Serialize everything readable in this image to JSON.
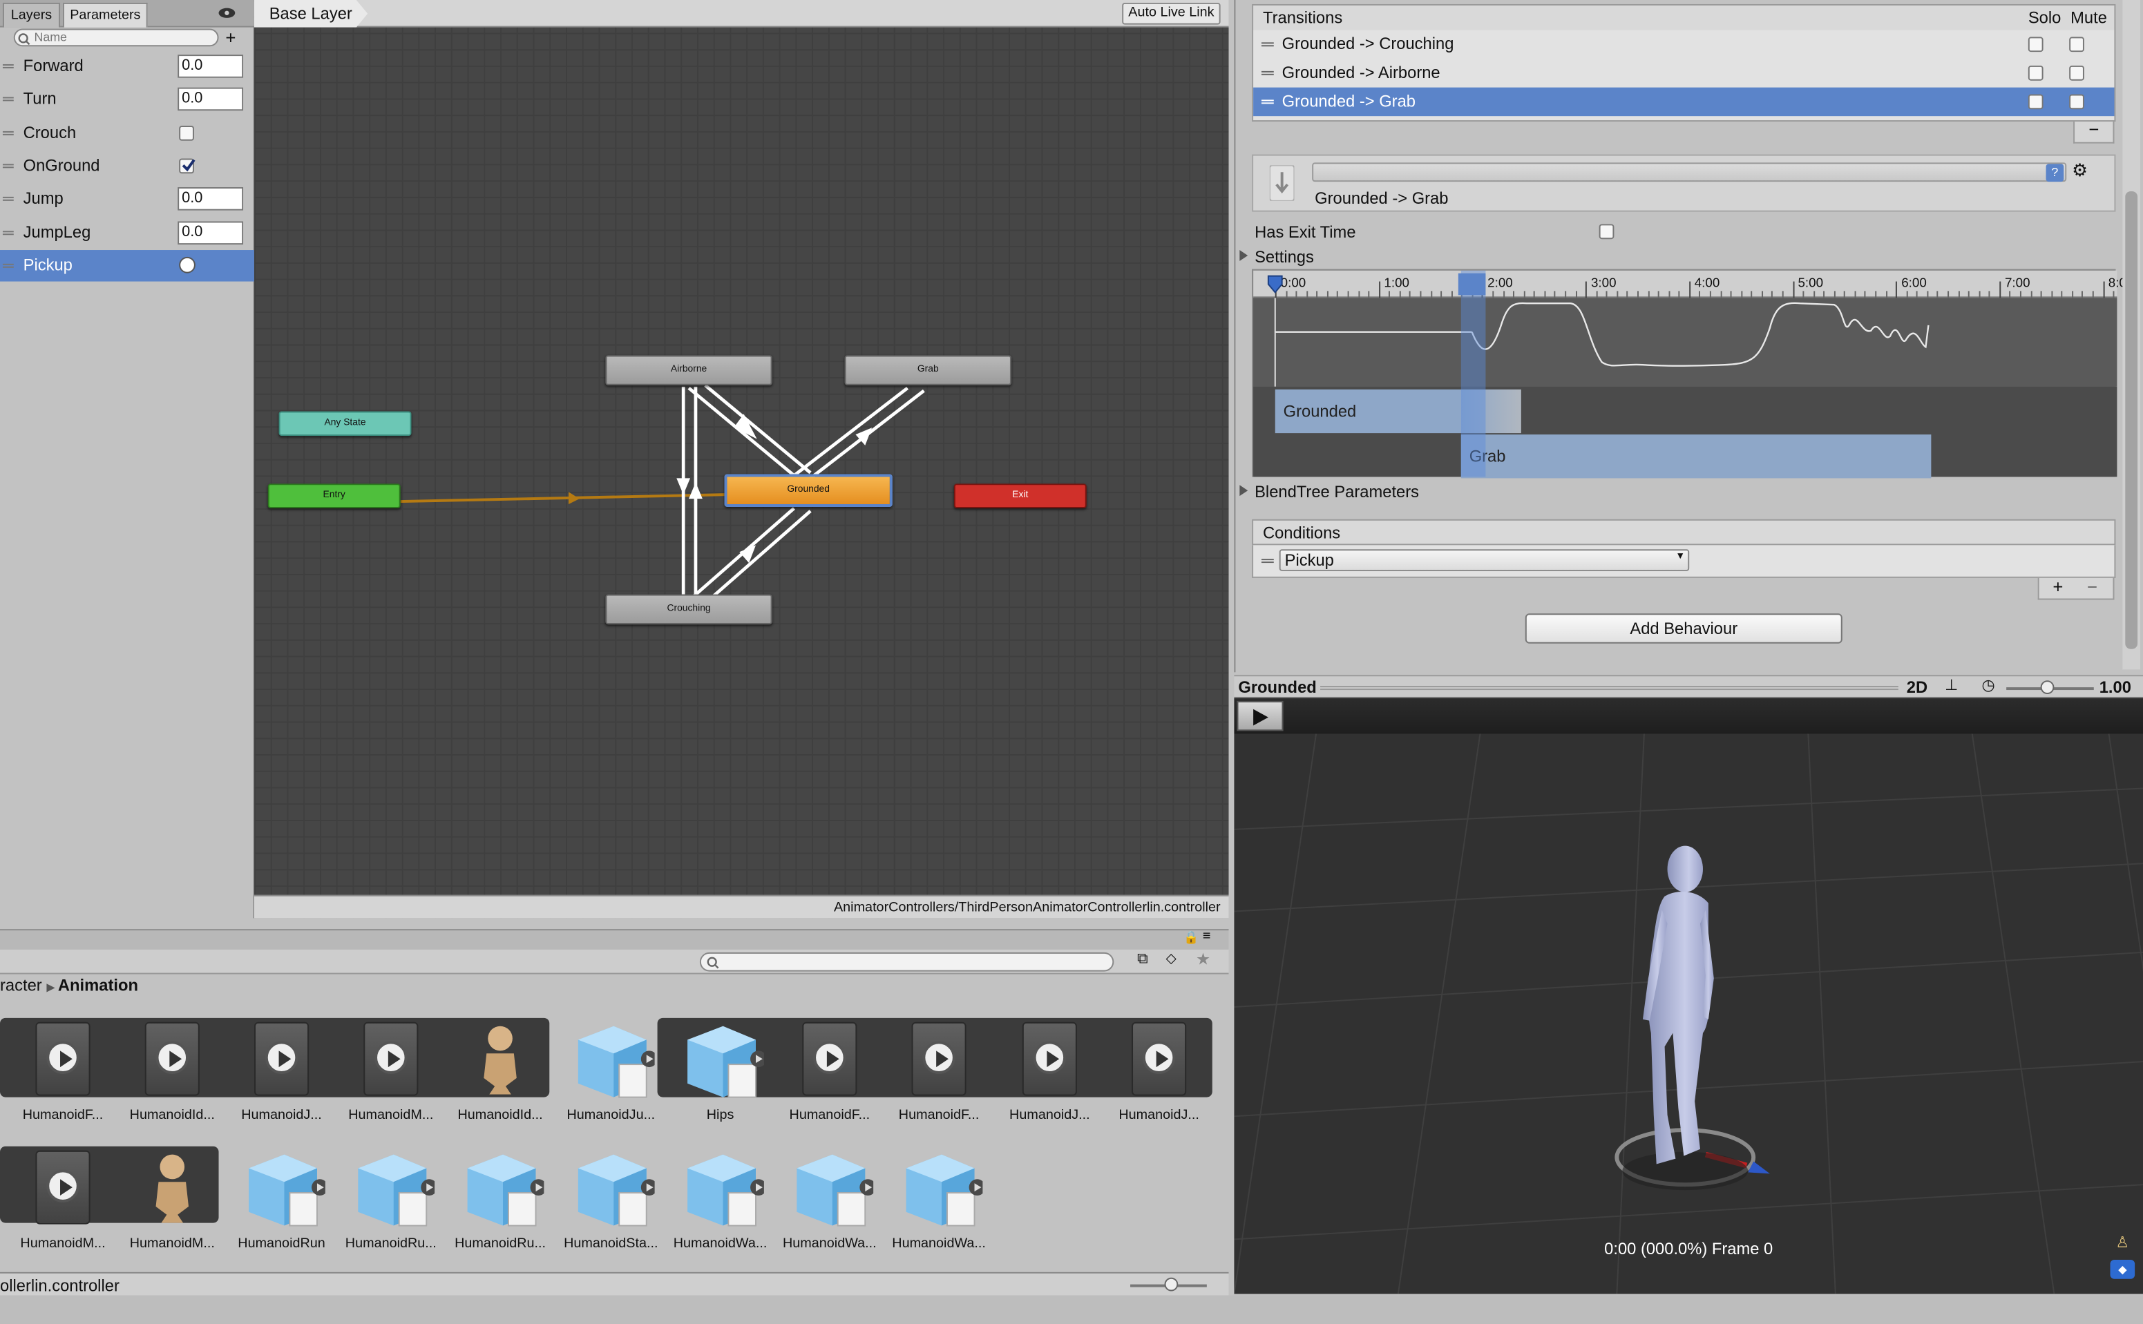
{
  "params_panel": {
    "tabs": [
      "Layers",
      "Parameters"
    ],
    "search_placeholder": "Name",
    "items": [
      {
        "name": "Forward",
        "kind": "float",
        "value": "0.0"
      },
      {
        "name": "Turn",
        "kind": "float",
        "value": "0.0"
      },
      {
        "name": "Crouch",
        "kind": "bool",
        "checked": false
      },
      {
        "name": "OnGround",
        "kind": "bool",
        "checked": true
      },
      {
        "name": "Jump",
        "kind": "float",
        "value": "0.0"
      },
      {
        "name": "JumpLeg",
        "kind": "float",
        "value": "0.0"
      },
      {
        "name": "Pickup",
        "kind": "trigger",
        "selected": true
      }
    ]
  },
  "graph": {
    "layer": "Base Layer",
    "live_link": "Auto Live Link",
    "states": {
      "airborne": "Airborne",
      "grab": "Grab",
      "any": "Any State",
      "entry": "Entry",
      "grounded": "Grounded",
      "exit": "Exit",
      "crouching": "Crouching"
    },
    "path": "AnimatorControllers/ThirdPersonAnimatorControllerlin.controller"
  },
  "inspector": {
    "transitions_header": "Transitions",
    "solo": "Solo",
    "mute": "Mute",
    "transitions": [
      "Grounded -> Crouching",
      "Grounded -> Airborne",
      "Grounded -> Grab"
    ],
    "selected_title": "Grounded -> Grab",
    "has_exit_time": "Has Exit Time",
    "settings": "Settings",
    "ticks": [
      "0:00",
      "1:00",
      "2:00",
      "3:00",
      "4:00",
      "5:00",
      "6:00",
      "7:00",
      "8:0"
    ],
    "bar_from": "Grounded",
    "bar_to": "Grab",
    "blendtree": "BlendTree Parameters",
    "conditions": "Conditions",
    "condition_value": "Pickup",
    "add_behaviour": "Add Behaviour"
  },
  "preview": {
    "title": "Grounded",
    "mode": "2D",
    "speed": "1.00",
    "time": "0:00 (000.0%) Frame 0"
  },
  "project": {
    "breadcrumb_prefix": "racter",
    "breadcrumb_current": "Animation",
    "row1": [
      "HumanoidF...",
      "HumanoidId...",
      "HumanoidJ...",
      "HumanoidM...",
      "HumanoidId...",
      "HumanoidJu...",
      "Hips",
      "HumanoidF...",
      "HumanoidF...",
      "HumanoidJ...",
      "HumanoidJ..."
    ],
    "row2": [
      "HumanoidM...",
      "HumanoidM...",
      "HumanoidRun",
      "HumanoidRu...",
      "HumanoidRu...",
      "HumanoidSta...",
      "HumanoidWa...",
      "HumanoidWa...",
      "HumanoidWa..."
    ],
    "status": "ollerlin.controller"
  },
  "colors": {
    "selection": "#5b84c9",
    "grounded": "#f0a030",
    "entry": "#4fbf3c",
    "exit": "#d0302a",
    "any_state": "#6cc7b5"
  }
}
